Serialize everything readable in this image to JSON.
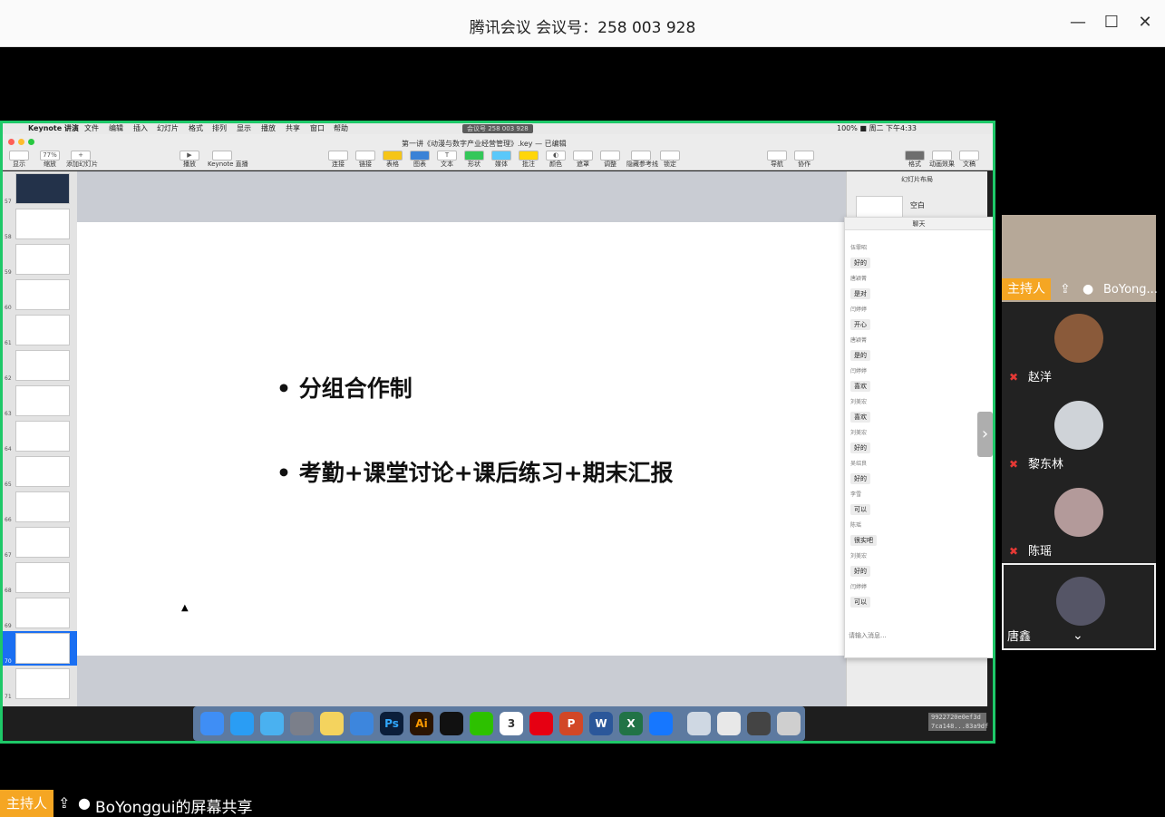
{
  "window": {
    "title": "腾讯会议 会议号：258 003 928",
    "minimize": "—",
    "maximize": "☐",
    "close": "✕"
  },
  "mac": {
    "menu": [
      "Keynote 讲演",
      "文件",
      "编辑",
      "插入",
      "幻灯片",
      "格式",
      "排列",
      "显示",
      "播放",
      "共享",
      "窗口",
      "帮助"
    ],
    "meeting_badge": "会议号 258 003 928",
    "status": "100% ■  周二 下午4:33"
  },
  "keynote": {
    "doc_title": "第一讲《动漫与数字产业经营管理》.key — 已编辑",
    "toolbar": [
      "显示",
      "缩放",
      "添加幻灯片",
      "播放",
      "Keynote 直播",
      "连接",
      "链接",
      "表格",
      "图表",
      "文本",
      "形状",
      "媒体",
      "批注",
      "颜色",
      "遮罩",
      "调整",
      "隐藏参考线",
      "锁定",
      "导航",
      "协作",
      "格式",
      "动画效果",
      "文稿"
    ],
    "zoom": "77%",
    "thumb_numbers": [
      "57",
      "58",
      "59",
      "60",
      "61",
      "62",
      "63",
      "64",
      "65",
      "66",
      "67",
      "68",
      "69",
      "70",
      "71"
    ],
    "selected_slide": "70",
    "slide_bullets": [
      "分组合作制",
      "考勤+课堂讨论+课后练习+期末汇报"
    ],
    "inspector_title": "幻灯片布局",
    "inspector_item": "空白"
  },
  "chat": {
    "title": "聊天",
    "messages": [
      {
        "name": "伍霏昭",
        "text": "好的"
      },
      {
        "name": "唐颖菁",
        "text": "是对"
      },
      {
        "name": "闫婷婷",
        "text": "开心"
      },
      {
        "name": "唐颖菁",
        "text": "是的"
      },
      {
        "name": "闫婷婷",
        "text": "喜欢"
      },
      {
        "name": "刘美宏",
        "text": "喜欢"
      },
      {
        "name": "刘美宏",
        "text": "好的"
      },
      {
        "name": "吴绍良",
        "text": "好的"
      },
      {
        "name": "李雪",
        "text": "可以"
      },
      {
        "name": "陈瑶",
        "text": "很实吧"
      },
      {
        "name": "刘美宏",
        "text": "好的"
      },
      {
        "name": "闫婷婷",
        "text": "可以"
      }
    ],
    "input_placeholder": "请输入消息..."
  },
  "stamp": [
    "9922720e0ef3d",
    "7ca148...83a9df"
  ],
  "participants": {
    "host_tag": "主持人",
    "host_name": "BoYong...",
    "list": [
      {
        "name": "赵洋"
      },
      {
        "name": "黎东林"
      },
      {
        "name": "陈瑶"
      },
      {
        "name": "唐鑫"
      }
    ]
  },
  "bottom": {
    "host_tag": "主持人",
    "share_text": "BoYonggui的屏幕共享"
  },
  "colors": {
    "accent": "#f5a623",
    "share_border": "#1ec868",
    "muted": "#e53935",
    "selected": "#1a6ff2"
  }
}
